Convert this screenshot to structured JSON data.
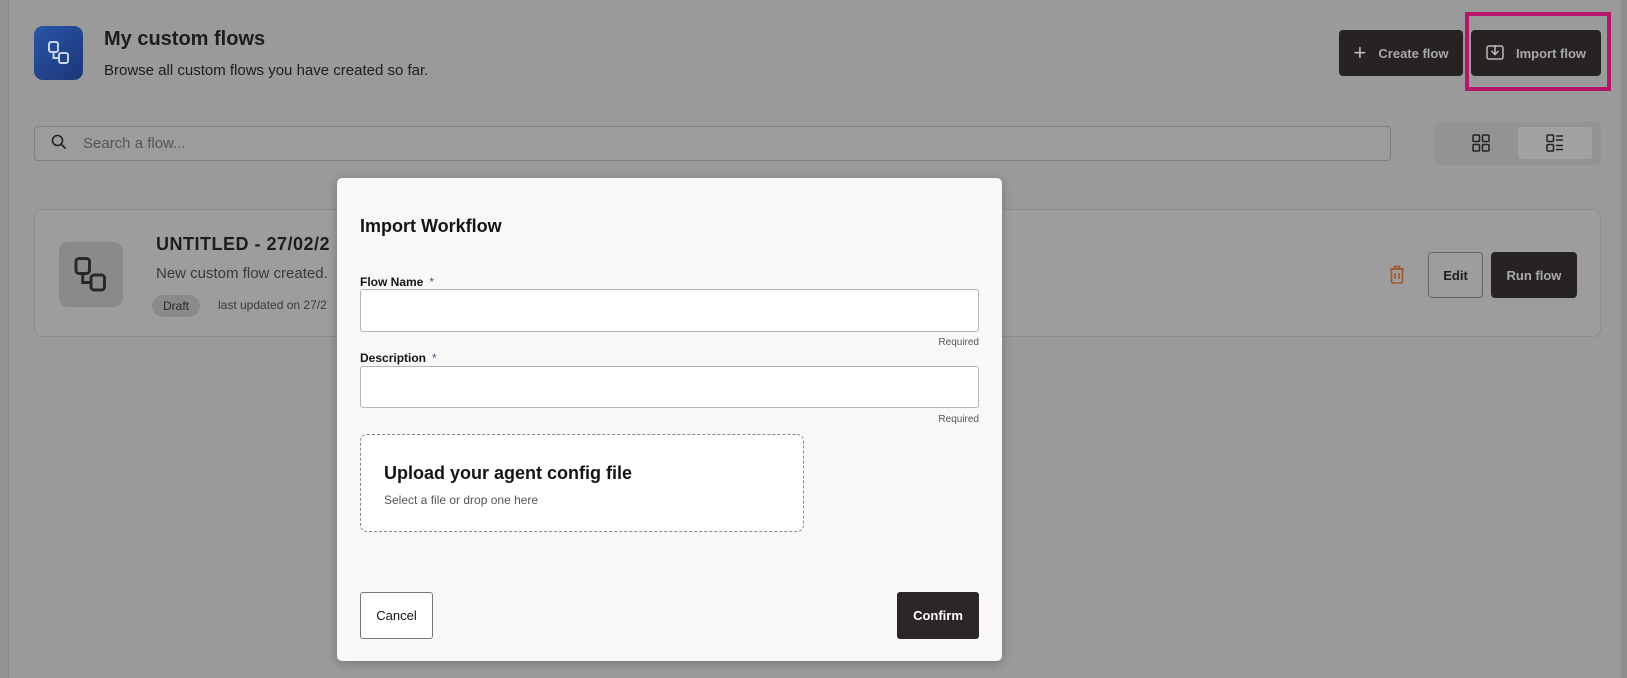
{
  "header": {
    "title": "My custom flows",
    "subtitle": "Browse all custom flows you have created so far.",
    "create_label": "Create flow",
    "import_label": "Import flow"
  },
  "search": {
    "placeholder": "Search a flow..."
  },
  "flows": [
    {
      "title": "UNTITLED - 27/02/2",
      "description": "New custom flow created.",
      "status": "Draft",
      "updated": "last updated on 27/2",
      "edit_label": "Edit",
      "run_label": "Run flow"
    }
  ],
  "modal": {
    "title": "Import Workflow",
    "flow_name_label": "Flow Name",
    "description_label": "Description",
    "required_marker": "*",
    "required_hint": "Required",
    "flow_name_value": "",
    "description_value": "",
    "upload_title": "Upload your agent config file",
    "upload_subtitle": "Select a file or drop one here",
    "cancel_label": "Cancel",
    "confirm_label": "Confirm"
  },
  "colors": {
    "highlight": "#b5166a",
    "primary_button": "#262322",
    "delete_icon": "#a0562a"
  }
}
